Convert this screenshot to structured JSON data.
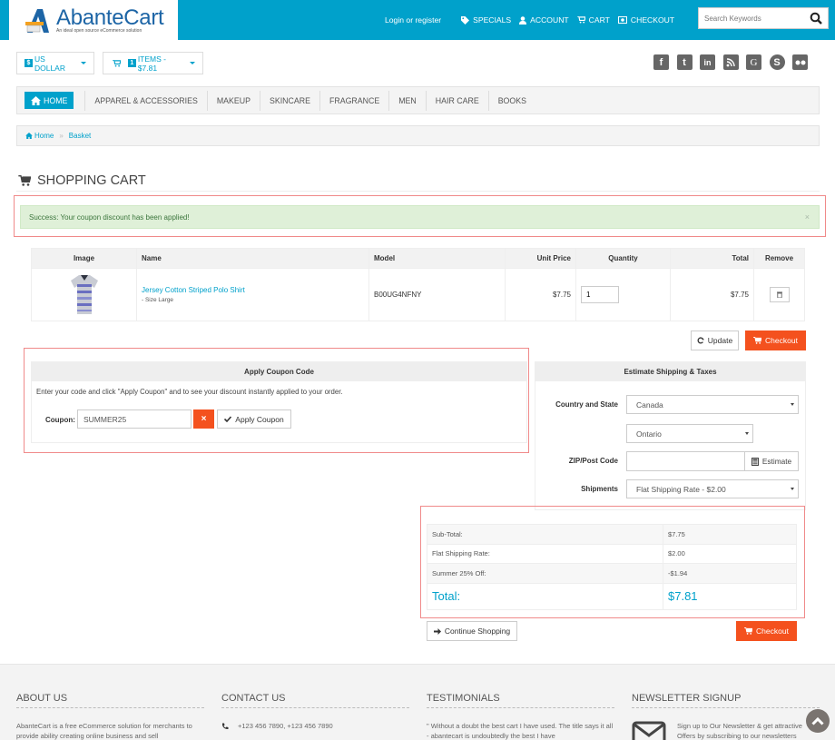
{
  "header": {
    "logo_title": "AbanteCart",
    "logo_subtitle": "An ideal open source eCommerce solution",
    "login_link": "Login or register",
    "links": [
      {
        "label": "SPECIALS",
        "icon": "tag-icon"
      },
      {
        "label": "ACCOUNT",
        "icon": "user-icon"
      },
      {
        "label": "CART",
        "icon": "cart-icon"
      },
      {
        "label": "CHECKOUT",
        "icon": "money-icon"
      }
    ],
    "search_placeholder": "Search Keywords",
    "brand_color": "#00a1cb"
  },
  "currency": {
    "symbol_badge": "$",
    "label": "US DOLLAR"
  },
  "mini_cart": {
    "count": "1",
    "label": "ITEMS - $7.81"
  },
  "social": [
    "facebook",
    "twitter",
    "linkedin",
    "rss",
    "google",
    "skype",
    "flickr"
  ],
  "nav": {
    "home": "HOME",
    "items": [
      "APPAREL & ACCESSORIES",
      "MAKEUP",
      "SKINCARE",
      "FRAGRANCE",
      "MEN",
      "HAIR CARE",
      "BOOKS"
    ]
  },
  "breadcrumb": {
    "home": "Home",
    "separator": "»",
    "current": "Basket"
  },
  "page_title": "SHOPPING CART",
  "alert": {
    "message": "Success: Your coupon discount has been applied!",
    "close": "×"
  },
  "cart_table": {
    "headers": [
      "Image",
      "Name",
      "Model",
      "Unit Price",
      "Quantity",
      "Total",
      "Remove"
    ],
    "rows": [
      {
        "name": "Jersey Cotton Striped Polo Shirt",
        "option": "- Size Large",
        "model": "B00UG4NFNY",
        "unit_price": "$7.75",
        "quantity": "1",
        "total": "$7.75"
      }
    ]
  },
  "buttons": {
    "update": "Update",
    "checkout": "Checkout",
    "continue": "Continue Shopping",
    "apply_coupon": "Apply Coupon",
    "estimate": "Estimate",
    "clear_coupon": "×"
  },
  "coupon": {
    "title": "Apply Coupon Code",
    "instructions": "Enter your code and click \"Apply Coupon\" and to see your discount instantly applied to your order.",
    "label": "Coupon:",
    "value": "SUMMER25"
  },
  "shipping": {
    "title": "Estimate Shipping & Taxes",
    "country_label": "Country and State",
    "country": "Canada",
    "state": "Ontario",
    "zip_label": "ZIP/Post Code",
    "zip_value": "",
    "shipments_label": "Shipments",
    "shipment": "Flat Shipping Rate - $2.00"
  },
  "totals": [
    {
      "label": "Sub-Total:",
      "value": "$7.75"
    },
    {
      "label": "Flat Shipping Rate:",
      "value": "$2.00"
    },
    {
      "label": "Summer 25% Off:",
      "value": "-$1.94"
    },
    {
      "label": "Total:",
      "value": "$7.81"
    }
  ],
  "footer": {
    "about_title": "ABOUT US",
    "about_text": "AbanteCart is a free eCommerce solution for merchants to provide ability creating online business and sell",
    "contact_title": "CONTACT US",
    "contact_phone": "+123 456 7890, +123 456 7890",
    "testimonials_title": "TESTIMONIALS",
    "testimonials_text": "\" Without a doubt the best cart I have used. The title says it all - abantecart is undoubtedly the best I have",
    "newsletter_title": "NEWSLETTER SIGNUP",
    "newsletter_text": "Sign up to Our Newsletter & get attractive Offers by subscribing to our newsletters"
  },
  "accent_orange": "#f4511e"
}
